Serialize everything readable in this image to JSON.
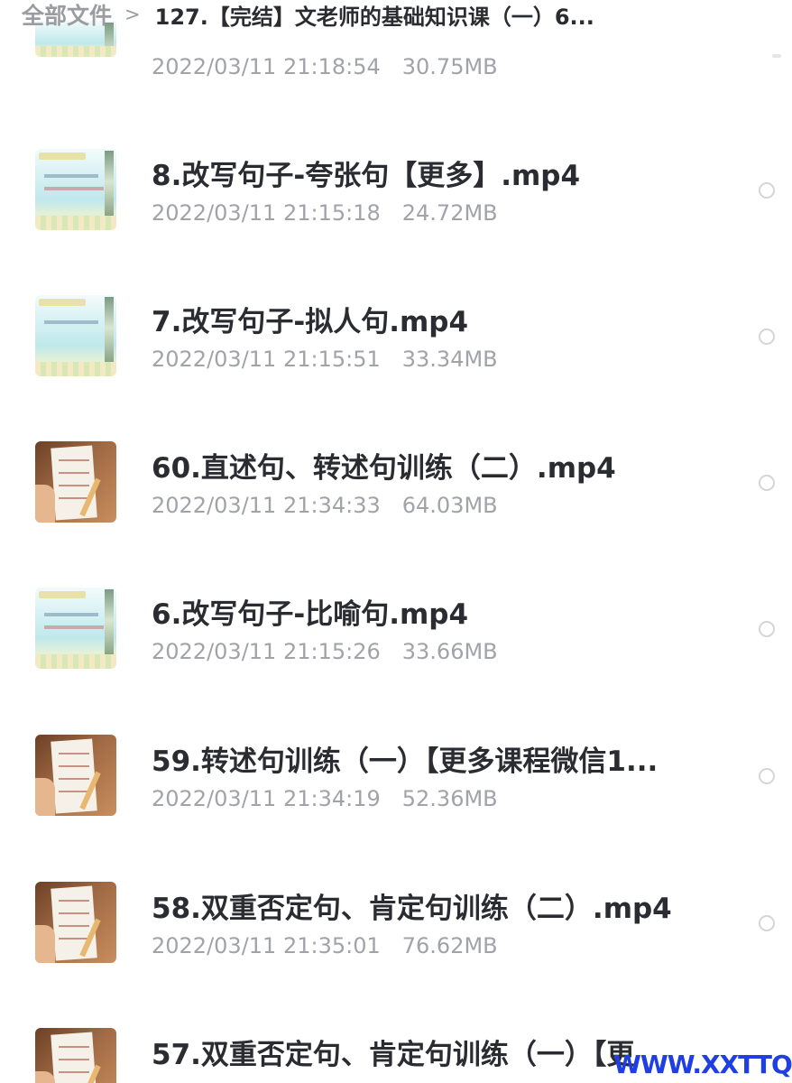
{
  "breadcrumb": {
    "root": "全部文件",
    "separator": ">",
    "current": "127.【完结】文老师的基础知识课（一）6..."
  },
  "files": [
    {
      "name": "",
      "date": "2022/03/11 21:18:54",
      "size": "30.75MB",
      "thumb": "board"
    },
    {
      "name": "8.改写句子-夸张句【更多】.mp4",
      "date": "2022/03/11 21:15:18",
      "size": "24.72MB",
      "thumb": "board"
    },
    {
      "name": "7.改写句子-拟人句.mp4",
      "date": "2022/03/11 21:15:51",
      "size": "33.34MB",
      "thumb": "board"
    },
    {
      "name": "60.直述句、转述句训练（二）.mp4",
      "date": "2022/03/11 21:34:33",
      "size": "64.03MB",
      "thumb": "hand"
    },
    {
      "name": "6.改写句子-比喻句.mp4",
      "date": "2022/03/11 21:15:26",
      "size": "33.66MB",
      "thumb": "board"
    },
    {
      "name": "59.转述句训练（一）【更多课程微信1...",
      "date": "2022/03/11 21:34:19",
      "size": "52.36MB",
      "thumb": "hand"
    },
    {
      "name": "58.双重否定句、肯定句训练（二）.mp4",
      "date": "2022/03/11 21:35:01",
      "size": "76.62MB",
      "thumb": "hand"
    },
    {
      "name": "57.双重否定句、肯定句训练（一）【更",
      "date": "",
      "size": "",
      "thumb": "hand"
    }
  ],
  "watermark": "WWW.XXTTQ.COM"
}
